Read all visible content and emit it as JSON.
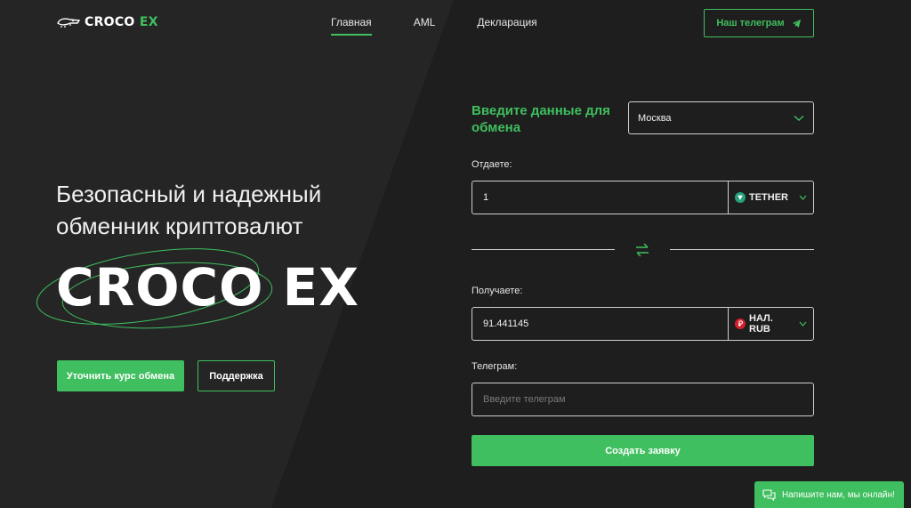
{
  "header": {
    "logo": {
      "text": "CROCO",
      "accent": "EX"
    },
    "nav": [
      {
        "label": "Главная",
        "active": true
      },
      {
        "label": "AML",
        "active": false
      },
      {
        "label": "Декларация",
        "active": false
      }
    ],
    "telegram_button": "Наш телеграм"
  },
  "hero": {
    "title": "Безопасный и надежный обменник криптовалют",
    "brand": "CROCO EX",
    "rate_button": "Уточнить курс обмена",
    "support_button": "Поддержка"
  },
  "form": {
    "title": "Введите данные для обмена",
    "city": "Москва",
    "give": {
      "label": "Отдаете:",
      "value": "1",
      "currency": "TETHER",
      "currency_icon": "tether-icon"
    },
    "get": {
      "label": "Получаете:",
      "value": "91.441145",
      "currency": "НАЛ. RUB",
      "currency_icon": "ruble-icon"
    },
    "telegram": {
      "label": "Телеграм:",
      "placeholder": "Введите телеграм"
    },
    "submit": "Создать заявку"
  },
  "chat": {
    "label": "Напишите нам, мы онлайн!"
  },
  "colors": {
    "accent": "#3fbf5f",
    "background": "#1e1e1e",
    "panel": "#252525",
    "tether": "#26a17b",
    "ruble": "#d4202c"
  }
}
